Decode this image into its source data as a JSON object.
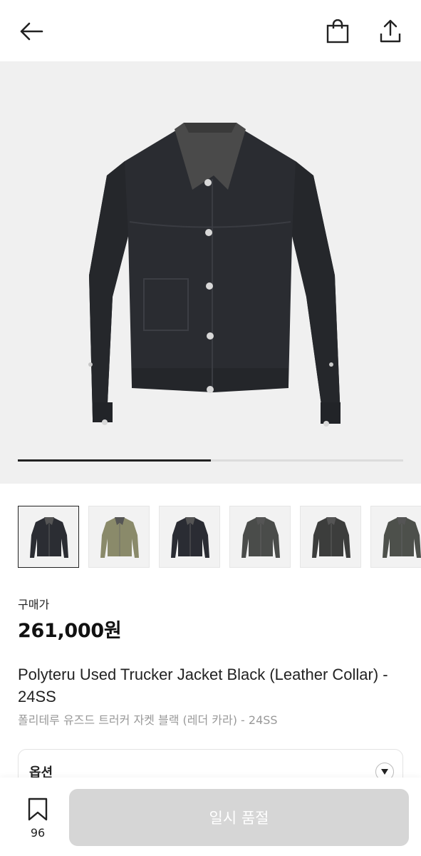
{
  "header": {
    "back_icon": "arrow-left-icon",
    "bag_icon": "shopping-bag-icon",
    "share_icon": "share-upload-icon"
  },
  "gallery": {
    "current_index": 1,
    "total": 2,
    "progress_fraction": 0.5,
    "jacket_color": "#2a2c31",
    "collar_color": "#4a4a4a"
  },
  "thumbnails": [
    {
      "name": "thumb-black-leather-collar",
      "color": "#2b2d33",
      "selected": true
    },
    {
      "name": "thumb-camo",
      "color": "#8a8a6a",
      "selected": false
    },
    {
      "name": "thumb-black-2",
      "color": "#2a2c33",
      "selected": false
    },
    {
      "name": "thumb-dark-grey",
      "color": "#4a4c4a",
      "selected": false
    },
    {
      "name": "thumb-charcoal",
      "color": "#3c3d3c",
      "selected": false
    },
    {
      "name": "thumb-grey-green",
      "color": "#4d504b",
      "selected": false
    }
  ],
  "product": {
    "price_label": "구매가",
    "price": "261,000원",
    "title_en": "Polyteru Used Trucker Jacket Black (Leather Collar) - 24SS",
    "title_ko": "폴리테루 유즈드 트러커 자켓 블랙 (레더 카라) - 24SS"
  },
  "options": {
    "label": "옵션",
    "arrow_icon": "triangle-down-icon"
  },
  "bottom": {
    "bookmark_icon": "bookmark-icon",
    "bookmark_count": "96",
    "buy_button_label": "일시 품절"
  }
}
